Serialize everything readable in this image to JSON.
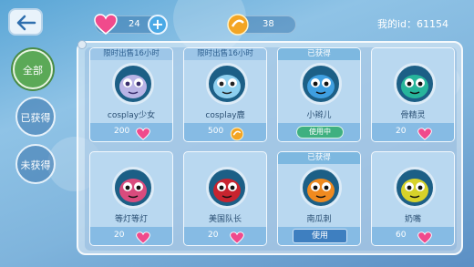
{
  "header": {
    "back_icon": "back-arrow-icon",
    "gems": "24",
    "coins": "38",
    "my_id": "我的id：61154"
  },
  "sidebar": {
    "items": [
      {
        "label": "全部",
        "active": true
      },
      {
        "label": "已获得",
        "active": false
      },
      {
        "label": "未获得",
        "active": false
      }
    ]
  },
  "pets": [
    {
      "banner": "限时出售16小时",
      "name": "cosplay少女",
      "price": "200",
      "currency": "gem",
      "face": "#b9b4e6",
      "eyes": "#3a2f6e",
      "status": "price"
    },
    {
      "banner": "限时出售16小时",
      "name": "cosplay鹿",
      "price": "500",
      "currency": "coin",
      "face": "#8ed0ef",
      "eyes": "#222",
      "status": "price"
    },
    {
      "banner": "已获得",
      "name": "小辫儿",
      "badge": "使用中",
      "face": "#3f9fe0",
      "eyes": "#111",
      "status": "inuse"
    },
    {
      "banner": "",
      "name": "骨精灵",
      "price": "20",
      "currency": "gem",
      "face": "#27b59b",
      "eyes": "#111",
      "status": "price"
    },
    {
      "banner": "",
      "name": "等灯等灯",
      "price": "20",
      "currency": "gem",
      "face": "#d94b7d",
      "eyes": "#111",
      "status": "price"
    },
    {
      "banner": "",
      "name": "美国队长",
      "price": "20",
      "currency": "gem",
      "face": "#c8242f",
      "eyes": "#111",
      "status": "price"
    },
    {
      "banner": "已获得",
      "name": "南瓜刺",
      "button": "使用",
      "face": "#f08a1f",
      "eyes": "#111",
      "status": "use"
    },
    {
      "banner": "",
      "name": "奶嘴",
      "price": "60",
      "currency": "gem",
      "face": "#d7d22a",
      "eyes": "#111",
      "status": "price"
    }
  ]
}
